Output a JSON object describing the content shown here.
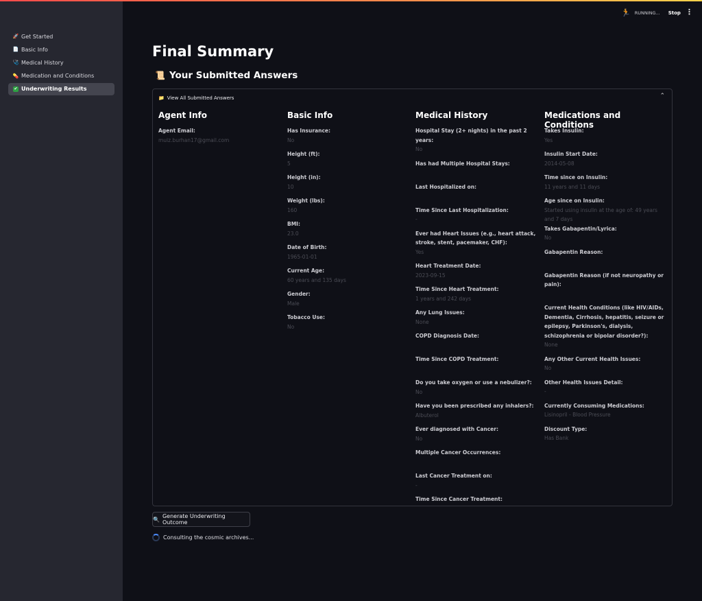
{
  "sidebar": {
    "items": [
      {
        "icon": "🚀",
        "label": "Get Started",
        "active": false
      },
      {
        "icon": "📄",
        "label": "Basic Info",
        "active": false
      },
      {
        "icon": "🩺",
        "label": "Medical History",
        "active": false
      },
      {
        "icon": "💊",
        "label": "Medication and Conditions",
        "active": false
      },
      {
        "icon": "✔",
        "label": "Underwriting Results",
        "active": true
      }
    ]
  },
  "header": {
    "status": "RUNNING...",
    "stop_label": "Stop",
    "menu_icon": "kebab-icon"
  },
  "main": {
    "title": "Final Summary",
    "section_title": "Your Submitted Answers",
    "expander_label": "View All Submitted Answers",
    "columns": [
      {
        "title": "Agent Info",
        "fields": [
          {
            "label": "Agent Email:",
            "value": "muiz.burhan17@gmail.com"
          }
        ]
      },
      {
        "title": "Basic Info",
        "fields": [
          {
            "label": "Has Insurance:",
            "value": "No"
          },
          {
            "label": "Height (ft):",
            "value": "5"
          },
          {
            "label": "Height (in):",
            "value": "10"
          },
          {
            "label": "Weight (lbs):",
            "value": "160"
          },
          {
            "label": "BMI:",
            "value": "23.0"
          },
          {
            "label": "Date of Birth:",
            "value": "1965-01-01"
          },
          {
            "label": "Current Age:",
            "value": "60 years and 135 days"
          },
          {
            "label": "Gender:",
            "value": "Male"
          },
          {
            "label": "Tobacco Use:",
            "value": "No"
          }
        ]
      },
      {
        "title": "Medical History",
        "fields": [
          {
            "label": "Hospital Stay (2+ nights) in the past 2 years:",
            "value": "No"
          },
          {
            "label": "Has had Multiple Hospital Stays:",
            "value": ""
          },
          {
            "label": "Last Hospitalized on:",
            "value": ""
          },
          {
            "label": "Time Since Last Hospitalization:",
            "value": "-"
          },
          {
            "label": "Ever had Heart Issues (e.g., heart attack, stroke, stent, pacemaker, CHF):",
            "value": "Yes"
          },
          {
            "label": "Heart Treatment Date:",
            "value": "2023-09-15"
          },
          {
            "label": "Time Since Heart Treatment:",
            "value": "1 years and 242 days"
          },
          {
            "label": "Any Lung Issues:",
            "value": "None"
          },
          {
            "label": "COPD Diagnosis Date:",
            "value": ""
          },
          {
            "label": "Time Since COPD Treatment:",
            "value": ""
          },
          {
            "label": "Do you take oxygen or use a nebulizer?:",
            "value": "No"
          },
          {
            "label": "Have you been prescribed any inhalers?:",
            "value": "Albuterol"
          },
          {
            "label": "Ever diagnosed with Cancer:",
            "value": "No"
          },
          {
            "label": "Multiple Cancer Occurrences:",
            "value": ""
          },
          {
            "label": "Last Cancer Treatment on:",
            "value": "-"
          },
          {
            "label": "Time Since Cancer Treatment:",
            "value": ""
          }
        ]
      },
      {
        "title": "Medications and Conditions",
        "fields": [
          {
            "label": "Takes Insulin:",
            "value": "Yes"
          },
          {
            "label": "Insulin Start Date:",
            "value": "2014-05-08"
          },
          {
            "label": "Time since on Insulin:",
            "value": "11 years and 11 days"
          },
          {
            "label": "Age since on Insulin:",
            "value": "Started using insulin at the age of: 49 years and 7 days"
          },
          {
            "label": "Takes Gabapentin/Lyrica:",
            "value": "No"
          },
          {
            "label": "Gabapentin Reason:",
            "value": ""
          },
          {
            "label": "Gabapentin Reason (if not neuropathy or pain):",
            "value": ""
          },
          {
            "label": "Current Health Conditions (like HIV/AIDs, Dementia, Cirrhosis, hepatitis, seizure or epilepsy, Parkinson's, dialysis, schizophrenia or bipolar disorder?):",
            "value": "None"
          },
          {
            "label": "Any Other Current Health Issues:",
            "value": "No"
          },
          {
            "label": "Other Health Issues Detail:",
            "value": "-"
          },
          {
            "label": "Currently Consuming Medications:",
            "value": "Lisinopril - Blood Pressure"
          },
          {
            "label": "Discount Type:",
            "value": "Has Bank"
          }
        ]
      }
    ],
    "generate_button": "Generate Underwriting Outcome",
    "spinner_text": "Consulting the cosmic archives..."
  }
}
